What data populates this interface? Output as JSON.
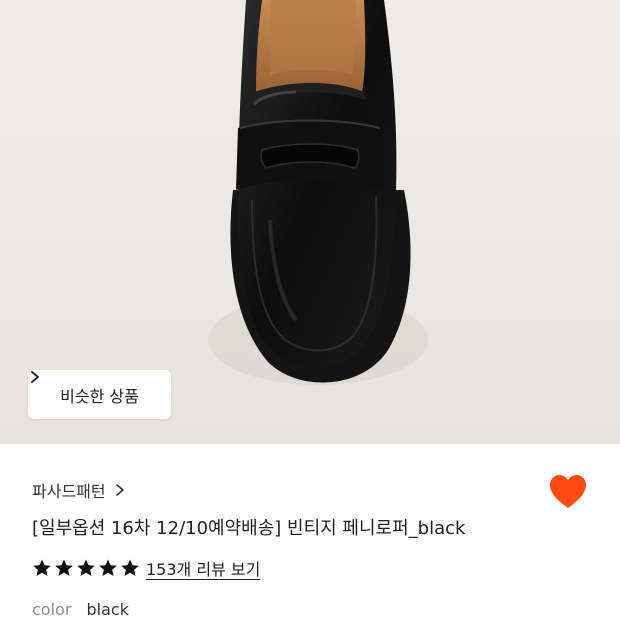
{
  "product_image": {
    "alt": "black penny loafer"
  },
  "similar_button": {
    "label": "비슷한 상품",
    "icon": "chevron-right-icon"
  },
  "brand": {
    "name": "파사드패턴",
    "icon": "chevron-right-icon"
  },
  "product": {
    "title": "[일부옵션 16차 12/10예약배송] 빈티지 페니로퍼_black"
  },
  "rating": {
    "stars": 5,
    "review_link": "153개 리뷰 보기"
  },
  "option": {
    "label": "color",
    "value": "black"
  },
  "wishlist": {
    "icon": "heart-icon",
    "active": true,
    "color": "#ff4b12"
  },
  "colors": {
    "background_hero": "#ebe8e3",
    "star": "#111111"
  }
}
